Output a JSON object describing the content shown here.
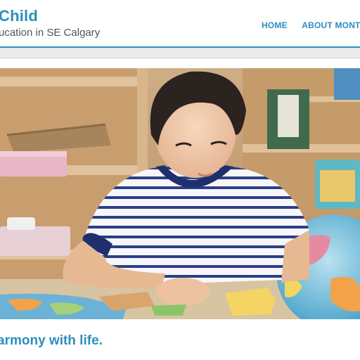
{
  "header": {
    "title": "Child",
    "tagline": "ucation in SE Calgary"
  },
  "nav": {
    "items": [
      {
        "label": "HOME"
      },
      {
        "label": "ABOUT MONTES"
      }
    ]
  },
  "hero": {
    "image_name": "child-with-puzzle-map-photo"
  },
  "slogan": {
    "text": "armony with life."
  },
  "colors": {
    "accent": "#2a8fbd",
    "tagline": "#555555",
    "subbar": "#ebebeb"
  }
}
